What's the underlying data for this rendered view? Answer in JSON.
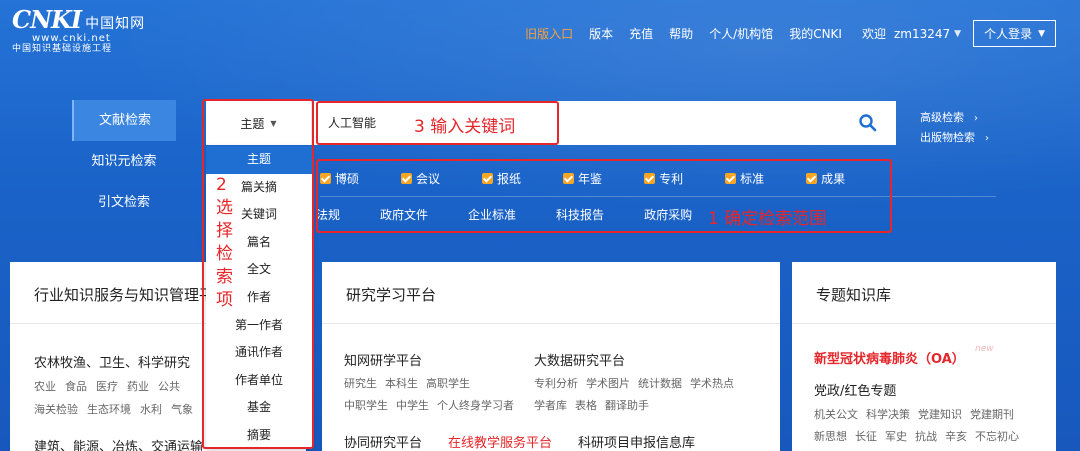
{
  "logo": {
    "brand": "CNKI",
    "brand_cn": "中国知网",
    "url": "www.cnki.net",
    "sub": "中国知识基础设施工程"
  },
  "topnav": {
    "items": [
      "旧版入口",
      "版本",
      "充值",
      "帮助",
      "个人/机构馆",
      "我的CNKI"
    ],
    "welcome": "欢迎",
    "username": "zm13247",
    "login": "个人登录"
  },
  "tabs": [
    "文献检索",
    "知识元检索",
    "引文检索"
  ],
  "search": {
    "field": "主题",
    "query": "人工智能"
  },
  "advanced": [
    "高级检索",
    "出版物检索"
  ],
  "dropdown": [
    "主题",
    "篇关摘",
    "关键词",
    "篇名",
    "全文",
    "作者",
    "第一作者",
    "通讯作者",
    "作者单位",
    "基金",
    "摘要"
  ],
  "checks": [
    "博硕",
    "会议",
    "报纸",
    "年鉴",
    "专利",
    "标准",
    "成果"
  ],
  "more_row": [
    "法规",
    "政府文件",
    "企业标准",
    "科技报告",
    "政府采购"
  ],
  "annotations": {
    "a1": "1 确定检索范围",
    "a2": "2\n选\n择\n检\n索\n项",
    "a3": "3 输入关键词"
  },
  "card1": {
    "title": "行业知识服务与知识管理平台",
    "heading1": "农林牧渔、卫生、科学研究",
    "line1": [
      "农业",
      "食品",
      "医疗",
      "药业",
      "公共"
    ],
    "line2": [
      "海关检验",
      "生态环境",
      "水利",
      "气象"
    ],
    "heading2": "建筑、能源、冶炼、交通运输"
  },
  "card2": {
    "title": "研究学习平台",
    "b1_h": "知网研学平台",
    "b1_l1": [
      "研究生",
      "本科生",
      "高职学生"
    ],
    "b1_l2": [
      "中职学生",
      "中学生",
      "个人终身学习者"
    ],
    "b2_h": "大数据研究平台",
    "b2_l1": [
      "专利分析",
      "学术图片",
      "统计数据",
      "学术热点"
    ],
    "b2_l2": [
      "学者库",
      "表格",
      "翻译助手"
    ],
    "bottom": [
      "协同研究平台",
      "在线教学服务平台",
      "科研项目申报信息库"
    ]
  },
  "card3": {
    "title": "专题知识库",
    "red": "新型冠状病毒肺炎（OA）",
    "new": "new",
    "heading": "党政/红色专题",
    "l1": [
      "机关公文",
      "科学决策",
      "党建知识",
      "党建期刊"
    ],
    "l2": [
      "新思想",
      "长征",
      "军史",
      "抗战",
      "辛亥",
      "不忘初心"
    ]
  },
  "colors": {
    "primary": "#1a63c8",
    "accent": "#f7a23b",
    "annotation": "#e5262a",
    "checkbox": "#f6a623"
  }
}
